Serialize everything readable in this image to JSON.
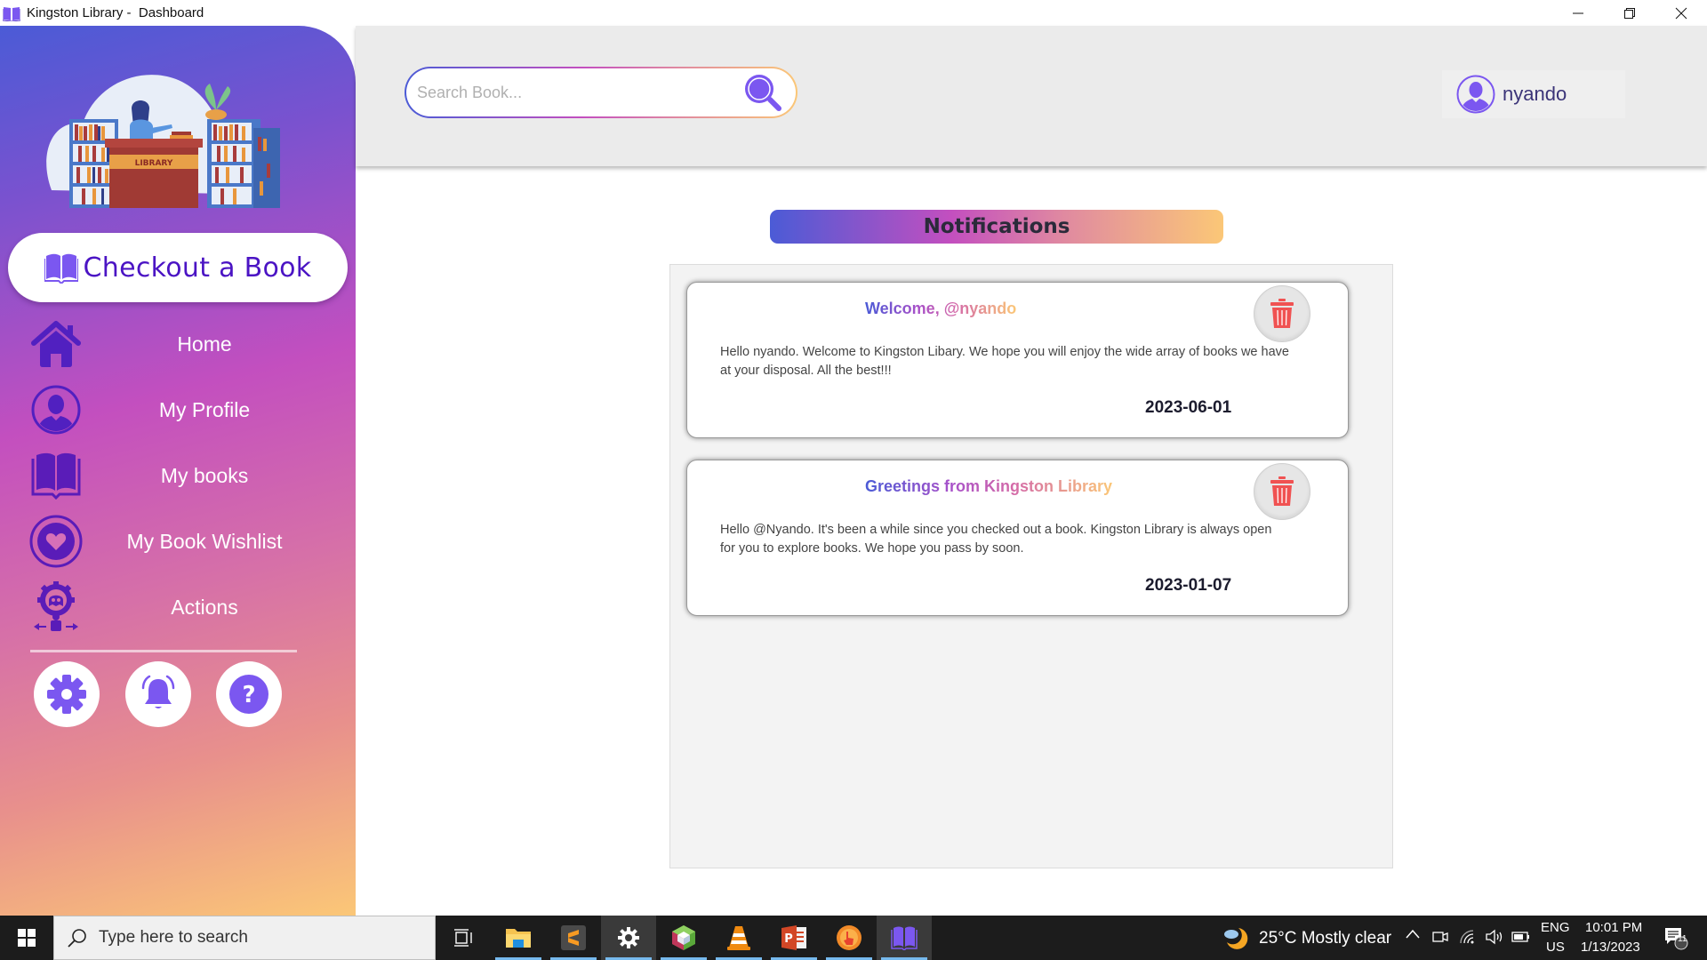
{
  "window": {
    "title": "Kingston Library -  Dashboard",
    "controls": [
      "minimize",
      "restore",
      "close"
    ]
  },
  "sidebar": {
    "hero_label": "LIBRARY",
    "checkout_label": "Checkout a Book",
    "nav": [
      {
        "label": "Home",
        "icon": "home-icon"
      },
      {
        "label": "My Profile",
        "icon": "profile-icon"
      },
      {
        "label": "My books",
        "icon": "book-icon"
      },
      {
        "label": "My Book Wishlist",
        "icon": "heart-icon"
      },
      {
        "label": "Actions",
        "icon": "actions-icon"
      }
    ],
    "bottom_buttons": [
      "settings",
      "notifications",
      "help"
    ]
  },
  "header": {
    "search_placeholder": "Search Book...",
    "search_value": "",
    "username": "nyando"
  },
  "main": {
    "title": "Notifications",
    "notifications": [
      {
        "title": "Welcome, @nyando",
        "body": "Hello nyando. Welcome to Kingston Libary. We hope you will enjoy the wide array of books we have at your disposal. All the best!!!",
        "date": "2023-06-01"
      },
      {
        "title": "Greetings from Kingston Library",
        "body": "Hello @Nyando. It's been a while since you checked out a book. Kingston Library is always open for you to explore books. We hope you pass by soon.",
        "date": "2023-01-07"
      }
    ]
  },
  "taskbar": {
    "search_placeholder": "Type here to search",
    "apps": [
      "task-view",
      "file-explorer",
      "sublime-text",
      "settings",
      "netbeans",
      "vlc",
      "powerpoint",
      "touch-app",
      "kingston-library"
    ],
    "weather": "25°C  Mostly clear",
    "language": "ENG",
    "region": "US",
    "time": "10:01 PM",
    "date": "1/13/2023",
    "notification_count": "11"
  },
  "colors": {
    "accent": "#7b57f0",
    "accent_dark": "#4b14c4",
    "gradient_start": "#4b5bd6",
    "gradient_mid": "#c34fbf",
    "gradient_end": "#fbc777",
    "trash": "#f05252"
  }
}
